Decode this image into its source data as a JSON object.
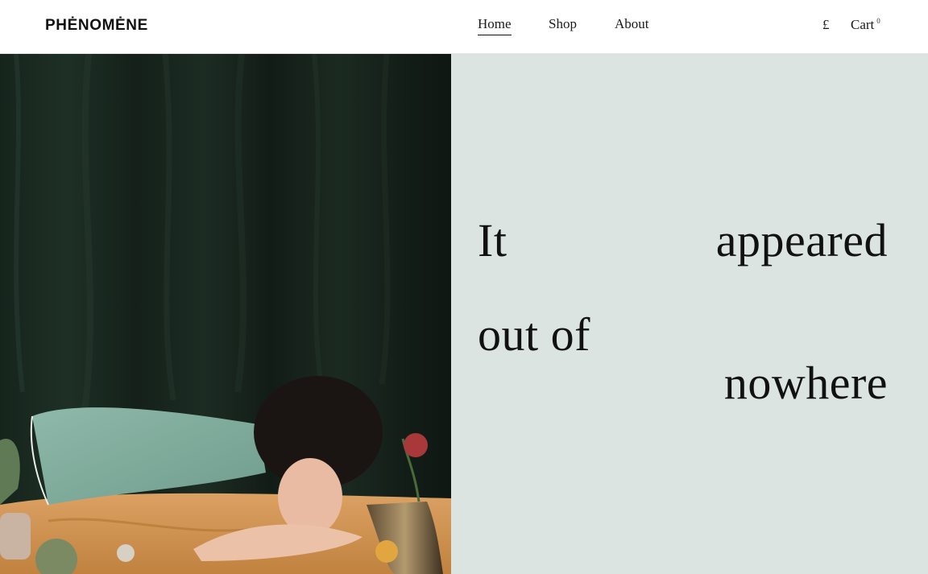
{
  "brand": {
    "name": "PHĖNOMĖNE"
  },
  "nav": {
    "items": [
      {
        "label": "Home",
        "active": true
      },
      {
        "label": "Shop",
        "active": false
      },
      {
        "label": "About",
        "active": false
      }
    ]
  },
  "header_actions": {
    "currency_symbol": "£",
    "cart_label": "Cart",
    "cart_count": "0"
  },
  "hero": {
    "headline_words": [
      "It",
      "appeared",
      "out of",
      "nowhere"
    ],
    "image_description_icon": "photo-image",
    "text_panel_color": "#dbe4e0",
    "curtain_color": "#16221b"
  }
}
